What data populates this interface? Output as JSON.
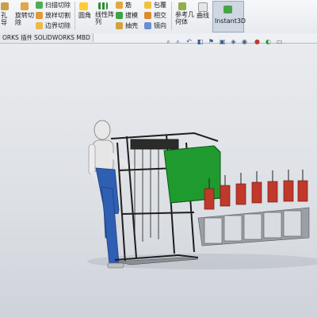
{
  "ribbon": {
    "hole_wizard_partial": "孔\n导",
    "revolve_cut": "旋转切\n除",
    "sweep_cut": "扫描切除",
    "loft_cut": "放样切割",
    "boundary_cut": "边界切除",
    "fillet": "圆角",
    "linear_pattern": "线性阵\n列",
    "rib": "筋",
    "draft": "拔模",
    "shell": "抽壳",
    "wrap": "包覆",
    "intersect": "相交",
    "mirror": "镜向",
    "reference_geometry": "参考几\n何体",
    "curves": "曲线",
    "instant3d": "Instant3D"
  },
  "tabs": [
    {
      "label": "ORKS 插件"
    },
    {
      "label": "SOLIDWORKS MBD"
    }
  ],
  "colors": {
    "frame": "#1e1e1e",
    "green_panel": "#1f9a2f",
    "pump_red": "#c0392b",
    "mannequin_blue": "#2f5fb3",
    "mannequin_skin": "#e8e8e8"
  }
}
